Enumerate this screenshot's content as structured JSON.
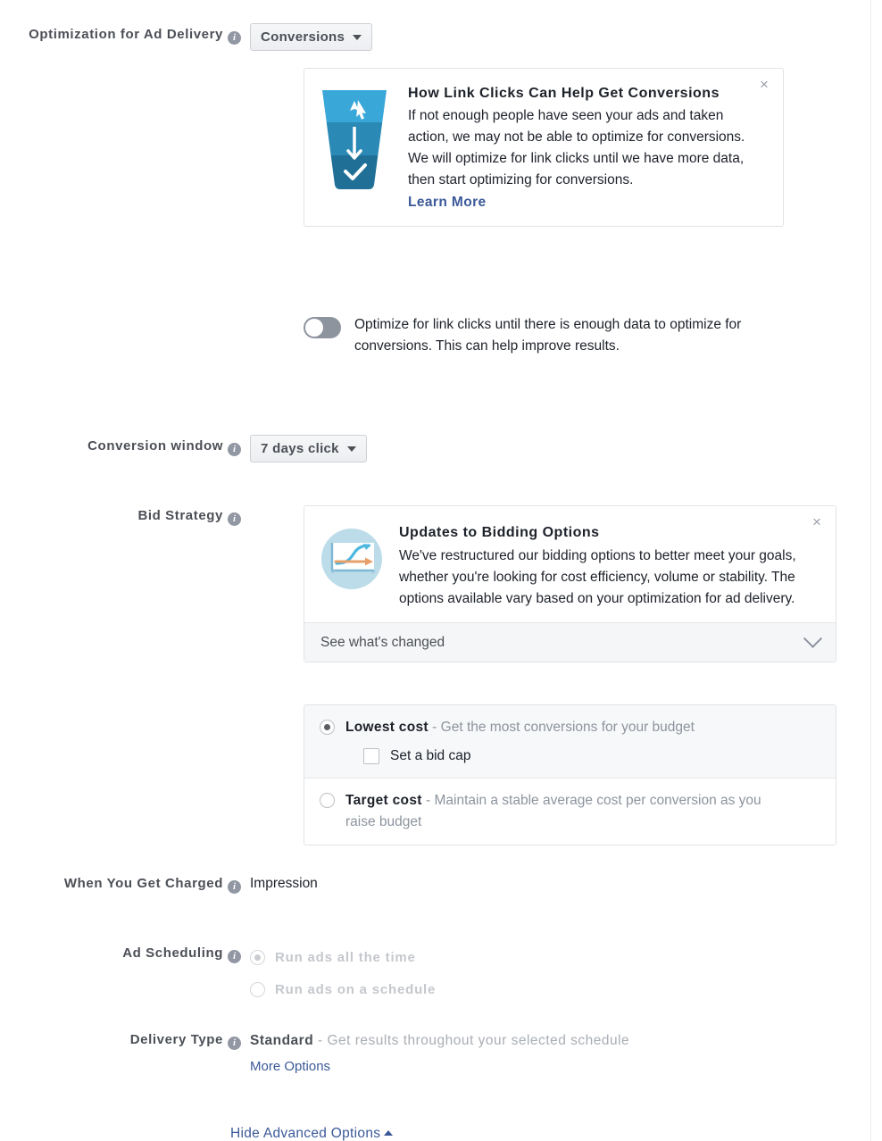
{
  "colors": {
    "link": "#3b5998",
    "label": "#4b4f56",
    "text": "#1d2129",
    "muted": "#8d949e",
    "disabled": "#c4c8cd",
    "card_border": "#e1e3e6",
    "footer_bg": "#f5f6f7",
    "funnel_top": "#3aa7d6",
    "funnel_mid": "#2a89b5",
    "funnel_bottom": "#1f6f97",
    "chart_circle": "#bcdcea",
    "chart_line_blue": "#4db8e0",
    "chart_line_orange": "#e8a06a"
  },
  "optimization": {
    "label": "Optimization for Ad Delivery",
    "info_glyph": "i",
    "dropdown_value": "Conversions",
    "card": {
      "title": "How Link Clicks Can Help Get Conversions",
      "body": "If not enough people have seen your ads and taken action, we may not be able to optimize for conversions. We will optimize for link clicks until we have more data, then start optimizing for conversions.",
      "link": "Learn More",
      "close_glyph": "×",
      "icon": "funnel-icon"
    },
    "toggle": {
      "state": "off",
      "text": "Optimize for link clicks until there is enough data to optimize for conversions. This can help improve results."
    }
  },
  "conversion_window": {
    "label": "Conversion window",
    "dropdown_value": "7 days click"
  },
  "bid_strategy": {
    "label": "Bid Strategy",
    "card": {
      "title": "Updates to Bidding Options",
      "body": "We've restructured our bidding options to better meet your goals, whether you're looking for cost efficiency, volume or stability. The options available vary based on your optimization for ad delivery.",
      "close_glyph": "×",
      "icon": "line-chart-icon",
      "footer_label": "See what's changed",
      "footer_icon": "chevron-down-icon"
    },
    "options": [
      {
        "name": "Lowest cost",
        "separator": " - ",
        "description": "Get the most conversions for your budget",
        "selected": true,
        "checkbox": {
          "label": "Set a bid cap",
          "checked": false
        }
      },
      {
        "name": "Target cost",
        "separator": " - ",
        "description": "Maintain a stable average cost per conversion as you raise budget",
        "selected": false
      }
    ]
  },
  "when_charged": {
    "label": "When You Get Charged",
    "value": "Impression"
  },
  "ad_scheduling": {
    "label": "Ad Scheduling",
    "disabled": true,
    "options": [
      {
        "label": "Run ads all the time",
        "selected": true
      },
      {
        "label": "Run ads on a schedule",
        "selected": false
      }
    ]
  },
  "delivery_type": {
    "label": "Delivery Type",
    "value_name": "Standard",
    "separator": " - ",
    "value_description": "Get results throughout your selected schedule",
    "more_options": "More Options"
  },
  "footer": {
    "hide_advanced": "Hide Advanced Options"
  }
}
